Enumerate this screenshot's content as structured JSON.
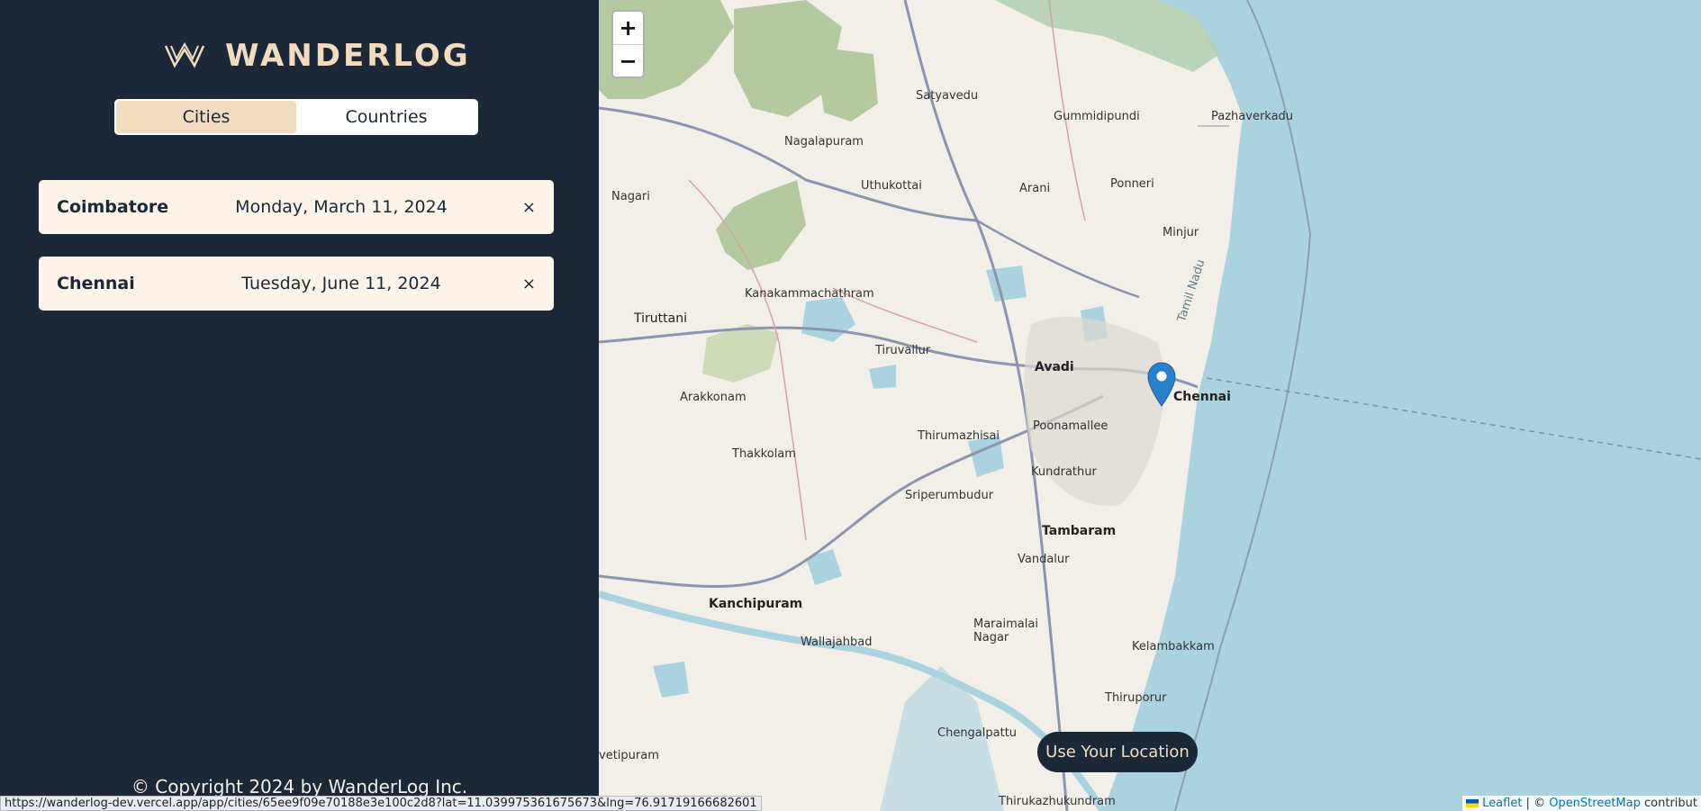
{
  "sidebar": {
    "logo_text": "WANDERLOG",
    "tabs": [
      {
        "label": "Cities",
        "active": true
      },
      {
        "label": "Countries",
        "active": false
      }
    ],
    "cities": [
      {
        "name": "Coimbatore",
        "date": "Monday, March 11, 2024",
        "remove": "×"
      },
      {
        "name": "Chennai",
        "date": "Tuesday, June 11, 2024",
        "remove": "×"
      }
    ],
    "copyright": "© Copyright 2024 by WanderLog Inc."
  },
  "status_bar": {
    "url": "https://wanderlog-dev.vercel.app/app/cities/65ee9f09e70188e3e100c2d8?lat=11.039975361675673&lng=76.91719166682601"
  },
  "map": {
    "zoom_in": "+",
    "zoom_out": "−",
    "use_location_label": "Use Your Location",
    "attribution": {
      "leaflet": "Leaflet",
      "separator": " | © ",
      "osm": "OpenStreetMap",
      "suffix": " contribut"
    },
    "places": [
      {
        "name": "Satyavedu"
      },
      {
        "name": "Gummidipundi"
      },
      {
        "name": "Pazhaverkadu"
      },
      {
        "name": "Nagalapuram"
      },
      {
        "name": "Uthukottai"
      },
      {
        "name": "Arani"
      },
      {
        "name": "Ponneri"
      },
      {
        "name": "Nagari"
      },
      {
        "name": "Minjur"
      },
      {
        "name": "Kanakammachathram"
      },
      {
        "name": "Tiruttani"
      },
      {
        "name": "Tiruvallur"
      },
      {
        "name": "Avadi"
      },
      {
        "name": "Chennai"
      },
      {
        "name": "Arakkonam"
      },
      {
        "name": "Thirumazhisai"
      },
      {
        "name": "Poonamallee"
      },
      {
        "name": "Thakkolam"
      },
      {
        "name": "Kundrathur"
      },
      {
        "name": "Sriperumbudur"
      },
      {
        "name": "Tambaram"
      },
      {
        "name": "Vandalur"
      },
      {
        "name": "Kanchipuram"
      },
      {
        "name": "Maraimalai Nagar"
      },
      {
        "name": "Wallajahbad"
      },
      {
        "name": "Kelambakkam"
      },
      {
        "name": "Thiruporur"
      },
      {
        "name": "Chengalpattu"
      },
      {
        "name": "Thirukazhukundram"
      },
      {
        "name": "vetipuram"
      },
      {
        "name": "Tamil Nadu"
      }
    ]
  },
  "colors": {
    "sidebar_bg": "#1b2838",
    "accent": "#f2dcc0",
    "card_bg": "#fcf3e9",
    "sea": "#aad3df",
    "marker": "#2a81cb"
  }
}
